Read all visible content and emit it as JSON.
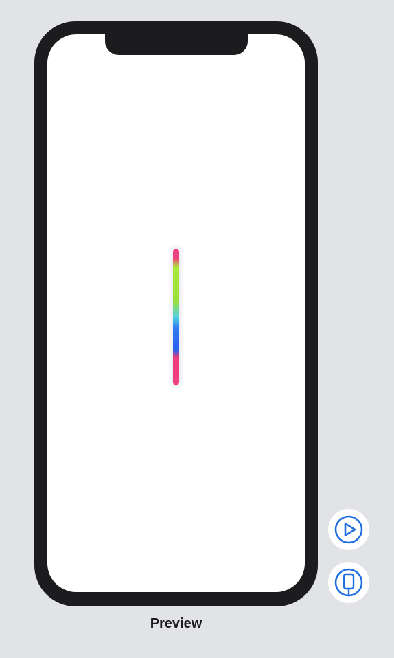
{
  "canvas": {
    "caption": "Preview"
  },
  "controls": {
    "play_icon": "play-circle-icon",
    "device_icon": "device-rotate-icon"
  },
  "colors": {
    "background": "#e1e3e7",
    "device_frame": "#1c1c1e",
    "screen": "#ffffff",
    "accent": "#1f6fe0",
    "rainbow": [
      "#f0407f",
      "#a7ea3a",
      "#52d1e2",
      "#2a5ff0",
      "#f0407f"
    ]
  }
}
